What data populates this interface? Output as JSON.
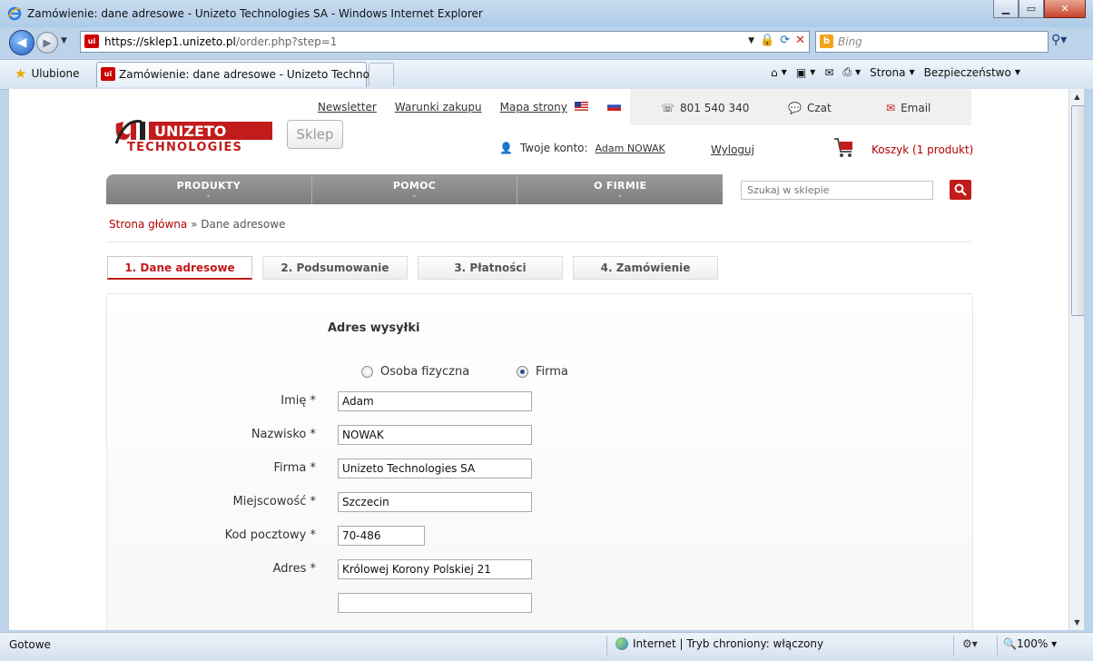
{
  "window": {
    "title": "Zamówienie: dane adresowe - Unizeto Technologies SA - Windows Internet Explorer",
    "controls": {
      "minimize": "▁",
      "maximize": "▭",
      "close": "✕"
    }
  },
  "browser": {
    "url_host": "https://sklep1.unizeto.pl",
    "url_rest": "/order.php?step=1",
    "search_placeholder": "Bing",
    "favorites_label": "Ulubione",
    "tab_label": "Zamówienie: dane adresowe - Unizeto Technolo...",
    "site_icon_text": "ui",
    "search_icon_text": "b",
    "commands": {
      "page": "Strona",
      "safety": "Bezpieczeństwo"
    }
  },
  "status": {
    "text": "Gotowe",
    "zone": "Internet | Tryb chroniony: włączony",
    "zoom": "100%"
  },
  "site": {
    "logo_text_top": "UNIZETO",
    "logo_text_bottom": "TECHNOLOGIES",
    "sklep_label": "Sklep",
    "toplinks": [
      "Newsletter",
      "Warunki zakupu",
      "Mapa strony"
    ],
    "phone": "801 540 340",
    "chat": "Czat",
    "email": "Email",
    "account_label": "Twoje konto:",
    "account_user": "Adam NOWAK",
    "logout": "Wyloguj",
    "cart": "Koszyk (1 produkt)",
    "nav": [
      "PRODUKTY",
      "POMOC",
      "O FIRMIE"
    ],
    "search_placeholder": "Szukaj w sklepie",
    "breadcrumb_home": "Strona główna",
    "breadcrumb_sep": " » ",
    "breadcrumb_current": "Dane adresowe",
    "steps": [
      "1. Dane adresowe",
      "2. Podsumowanie",
      "3. Płatności",
      "4. Zamówienie"
    ],
    "accent_color": "#c21b1b"
  },
  "form": {
    "section_title": "Adres wysyłki",
    "radio_private": "Osoba fizyczna",
    "radio_company": "Firma",
    "selected": "Firma",
    "fields": [
      {
        "label": "Imię *",
        "value": "Adam"
      },
      {
        "label": "Nazwisko *",
        "value": "NOWAK"
      },
      {
        "label": "Firma *",
        "value": "Unizeto Technologies SA"
      },
      {
        "label": "Miejscowość *",
        "value": "Szczecin"
      },
      {
        "label": "Kod pocztowy *",
        "value": "70-486"
      },
      {
        "label": "Adres *",
        "value": "Królowej Korony Polskiej 21"
      },
      {
        "label": "",
        "value": ""
      }
    ]
  }
}
